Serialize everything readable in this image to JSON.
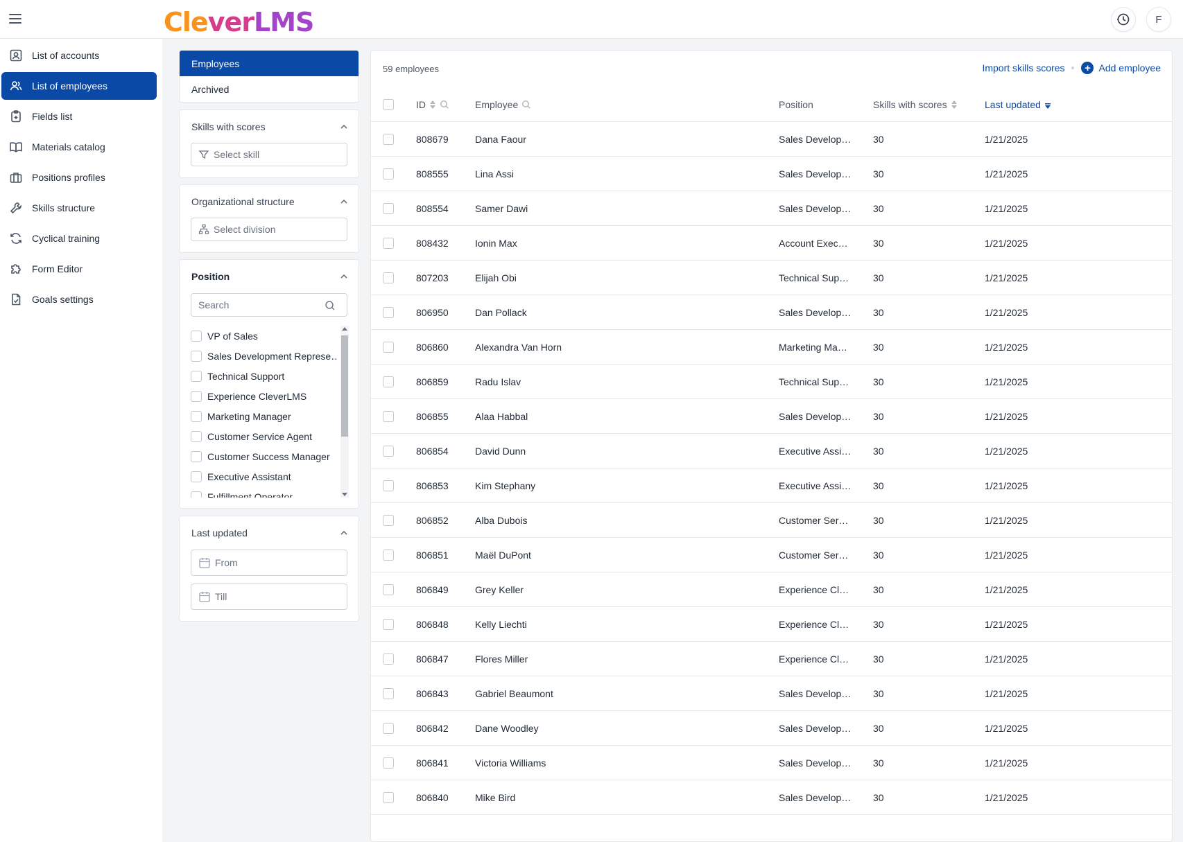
{
  "app": {
    "logo_part1": "Cle",
    "logo_part2": "v",
    "logo_part3": "er",
    "logo_part4": "LMS",
    "avatar_initial": "F"
  },
  "sidebar": {
    "items": [
      {
        "label": "List of accounts",
        "icon": "account-icon"
      },
      {
        "label": "List of employees",
        "icon": "employees-icon",
        "active": true
      },
      {
        "label": "Fields list",
        "icon": "clipboard-icon"
      },
      {
        "label": "Materials catalog",
        "icon": "book-icon"
      },
      {
        "label": "Positions profiles",
        "icon": "briefcase-icon"
      },
      {
        "label": "Skills structure",
        "icon": "wrench-icon"
      },
      {
        "label": "Cyclical training",
        "icon": "refresh-icon"
      },
      {
        "label": "Form Editor",
        "icon": "puzzle-icon"
      },
      {
        "label": "Goals settings",
        "icon": "file-check-icon"
      }
    ]
  },
  "filters": {
    "tabs": [
      "Employees",
      "Archived"
    ],
    "skills": {
      "title": "Skills with scores",
      "placeholder": "Select skill"
    },
    "org": {
      "title": "Organizational structure",
      "placeholder": "Select division"
    },
    "position": {
      "title": "Position",
      "search_placeholder": "Search",
      "options": [
        "VP of Sales",
        "Sales Development Represe…",
        "Technical Support",
        "Experience CleverLMS",
        "Marketing Manager",
        "Customer Service Agent",
        "Customer Success Manager",
        "Executive Assistant",
        "Fulfillment Operator"
      ]
    },
    "last_updated": {
      "title": "Last updated",
      "from_placeholder": "From",
      "till_placeholder": "Till"
    }
  },
  "table": {
    "count_label": "59 employees",
    "import_label": "Import skills scores",
    "add_label": "Add employee",
    "columns": {
      "id": "ID",
      "employee": "Employee",
      "position": "Position",
      "skills": "Skills with scores",
      "updated": "Last updated"
    },
    "rows": [
      {
        "id": "808679",
        "name": "Dana Faour",
        "position": "Sales Develop…",
        "skills": "30",
        "updated": "1/21/2025"
      },
      {
        "id": "808555",
        "name": "Lina Assi",
        "position": "Sales Develop…",
        "skills": "30",
        "updated": "1/21/2025"
      },
      {
        "id": "808554",
        "name": "Samer Dawi",
        "position": "Sales Develop…",
        "skills": "30",
        "updated": "1/21/2025"
      },
      {
        "id": "808432",
        "name": "Ionin Max",
        "position": "Account Execu…",
        "skills": "30",
        "updated": "1/21/2025"
      },
      {
        "id": "807203",
        "name": "Elijah Obi",
        "position": "Technical Sup…",
        "skills": "30",
        "updated": "1/21/2025"
      },
      {
        "id": "806950",
        "name": "Dan Pollack",
        "position": "Sales Develop…",
        "skills": "30",
        "updated": "1/21/2025"
      },
      {
        "id": "806860",
        "name": "Alexandra Van Horn",
        "position": "Marketing Man…",
        "skills": "30",
        "updated": "1/21/2025"
      },
      {
        "id": "806859",
        "name": "Radu Islav",
        "position": "Technical Sup…",
        "skills": "30",
        "updated": "1/21/2025"
      },
      {
        "id": "806855",
        "name": "Alaa Habbal",
        "position": "Sales Develop…",
        "skills": "30",
        "updated": "1/21/2025"
      },
      {
        "id": "806854",
        "name": "David Dunn",
        "position": "Executive Assi…",
        "skills": "30",
        "updated": "1/21/2025"
      },
      {
        "id": "806853",
        "name": "Kim Stephany",
        "position": "Executive Assi…",
        "skills": "30",
        "updated": "1/21/2025"
      },
      {
        "id": "806852",
        "name": "Alba Dubois",
        "position": "Customer Serv…",
        "skills": "30",
        "updated": "1/21/2025"
      },
      {
        "id": "806851",
        "name": "Maël DuPont",
        "position": "Customer Serv…",
        "skills": "30",
        "updated": "1/21/2025"
      },
      {
        "id": "806849",
        "name": "Grey Keller",
        "position": "Experience Cle…",
        "skills": "30",
        "updated": "1/21/2025"
      },
      {
        "id": "806848",
        "name": "Kelly Liechti",
        "position": "Experience Cle…",
        "skills": "30",
        "updated": "1/21/2025"
      },
      {
        "id": "806847",
        "name": "Flores Miller",
        "position": "Experience Cle…",
        "skills": "30",
        "updated": "1/21/2025"
      },
      {
        "id": "806843",
        "name": "Gabriel Beaumont",
        "position": "Sales Develop…",
        "skills": "30",
        "updated": "1/21/2025"
      },
      {
        "id": "806842",
        "name": "Dane Woodley",
        "position": "Sales Develop…",
        "skills": "30",
        "updated": "1/21/2025"
      },
      {
        "id": "806841",
        "name": "Victoria Williams",
        "position": "Sales Develop…",
        "skills": "30",
        "updated": "1/21/2025"
      },
      {
        "id": "806840",
        "name": "Mike Bird",
        "position": "Sales Develop…",
        "skills": "30",
        "updated": "1/21/2025"
      }
    ]
  },
  "colors": {
    "accent": "#0a4aa6",
    "logo_orange": "#f7931e",
    "logo_pink": "#d63c8b",
    "logo_purple": "#a344c8"
  }
}
